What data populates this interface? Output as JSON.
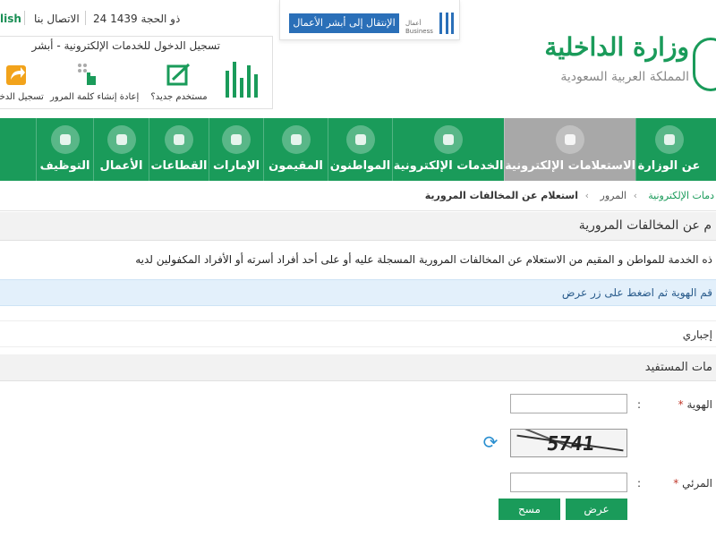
{
  "topbar": {
    "language_link": "lish",
    "contact_label": "الاتصال بنا",
    "date": "24 ذو الحجة 1439"
  },
  "business": {
    "switch_label": "الإنتقال إلى أبشر الأعمال",
    "logo_text_ar": "أعمال",
    "logo_text_en": "Business"
  },
  "login": {
    "title": "تسجيل الدخول للخدمات الإلكترونية - أبشر",
    "items": [
      {
        "label": "مستخدم جديد؟",
        "icon": "new-user-icon"
      },
      {
        "label": "إعادة إنشاء كلمة المرور",
        "icon": "reset-password-icon"
      },
      {
        "label": "تسجيل الدخول",
        "icon": "login-icon"
      }
    ]
  },
  "ministry": {
    "name": "وزارة الداخلية",
    "subtitle": "المملكة العربية السعودية"
  },
  "nav": {
    "items": [
      {
        "label": "عن الوزارة"
      },
      {
        "label": "الاستعلامات الإلكترونية",
        "active": true
      },
      {
        "label": "الخدمات الإلكترونية"
      },
      {
        "label": "المواطنون"
      },
      {
        "label": "المقيمون"
      },
      {
        "label": "الإمارات"
      },
      {
        "label": "القطاعات"
      },
      {
        "label": "الأعمال"
      },
      {
        "label": "التوظيف"
      }
    ]
  },
  "breadcrumb": {
    "items": [
      "دمات الإلكترونية",
      "المرور",
      "استعلام عن المخالفات المرورية"
    ]
  },
  "page": {
    "title": "م عن المخالفات المرورية",
    "description": "ذه الخدمة للمواطن و المقيم من الاستعلام عن المخالفات المرورية المسجلة عليه أو على أحد أفراد أسرته أو الأفراد المكفولين لديه",
    "instruction": "قم الهوية ثم اضغط على زر عرض",
    "option": "إجباري",
    "section_title": "مات المستفيد"
  },
  "form": {
    "id_label": "الهوية",
    "required_mark": "*",
    "visual_code_label": "المرئي",
    "colon": ":",
    "captcha_text": "5741",
    "id_value": "",
    "code_value": ""
  },
  "buttons": {
    "show": "عرض",
    "clear": "مسح"
  },
  "colors": {
    "primary_green": "#1a9b5a",
    "active_nav": "#a8a8a8",
    "business_blue": "#2a6fb8",
    "info_bg": "#e3f0fb"
  }
}
